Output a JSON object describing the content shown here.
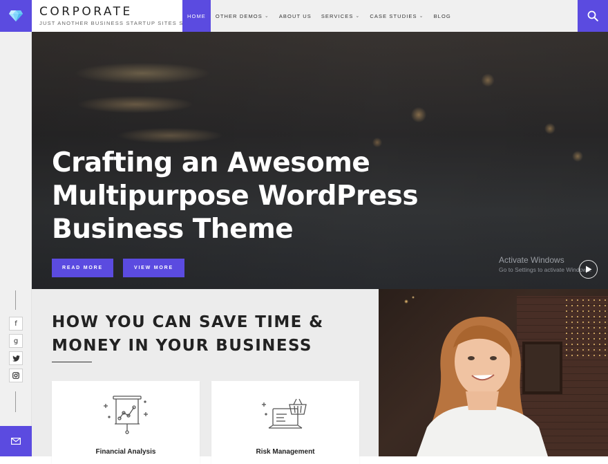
{
  "brand": {
    "title": "CORPORATE",
    "tagline": "JUST ANOTHER BUSINESS STARTUP SITES SITE"
  },
  "nav": {
    "items": [
      {
        "label": "HOME",
        "active": true,
        "dropdown": false
      },
      {
        "label": "OTHER DEMOS",
        "active": false,
        "dropdown": true
      },
      {
        "label": "ABOUT US",
        "active": false,
        "dropdown": false
      },
      {
        "label": "SERVICES",
        "active": false,
        "dropdown": true
      },
      {
        "label": "CASE STUDIES",
        "active": false,
        "dropdown": true
      },
      {
        "label": "BLOG",
        "active": false,
        "dropdown": false
      }
    ],
    "chevron": "⌄"
  },
  "social": {
    "facebook": "f",
    "google": "g",
    "twitter": "twitter-icon",
    "instagram": "instagram-icon"
  },
  "hero": {
    "title": "Crafting an Awesome Multipurpose WordPress Business Theme",
    "primary_button": "READ MORE",
    "secondary_button": "VIEW MORE"
  },
  "watermark": {
    "title": "Activate Windows",
    "subtitle": "Go to Settings to activate Windows."
  },
  "save_section": {
    "title": "HOW YOU CAN SAVE TIME & MONEY IN YOUR BUSINESS",
    "cards": [
      {
        "label": "Financial Analysis",
        "icon": "presentation-chart-icon"
      },
      {
        "label": "Risk Management",
        "icon": "laptop-basket-icon"
      }
    ]
  },
  "colors": {
    "accent": "#5b4be0",
    "header_bg": "#f0f0f0",
    "section_bg": "#ececec"
  }
}
